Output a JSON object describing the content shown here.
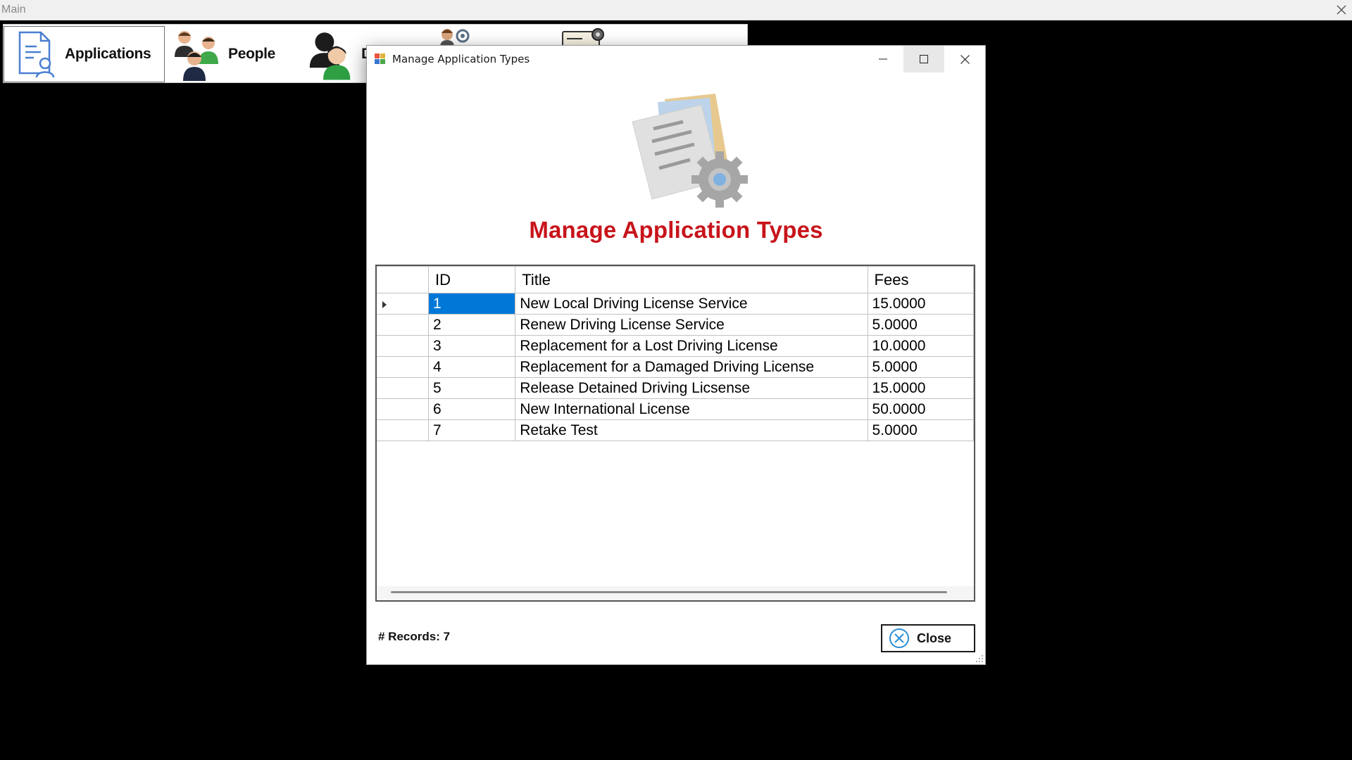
{
  "main_window": {
    "title": "Main"
  },
  "menu": {
    "items": [
      {
        "label": "Applications",
        "icon": "document-user-icon"
      },
      {
        "label": "People",
        "icon": "people-icon"
      },
      {
        "label": "D",
        "icon": "drivers-icon"
      },
      {
        "label": "",
        "icon": "user-settings-icon"
      },
      {
        "label": "",
        "icon": "account-card-icon"
      }
    ]
  },
  "dialog": {
    "title": "Manage Application Types",
    "heading": "Manage Application Types",
    "records_text": "# Records: 7",
    "close_label": "Close",
    "heading_color": "#c8141b",
    "selection_color": "#0078d7"
  },
  "grid": {
    "columns": [
      "ID",
      "Title",
      "Fees"
    ],
    "rows": [
      {
        "id": "1",
        "title": "New Local Driving License Service",
        "fees": "15.0000"
      },
      {
        "id": "2",
        "title": "Renew Driving License Service",
        "fees": "5.0000"
      },
      {
        "id": "3",
        "title": "Replacement for a Lost Driving License",
        "fees": "10.0000"
      },
      {
        "id": "4",
        "title": "Replacement for a Damaged Driving License",
        "fees": "5.0000"
      },
      {
        "id": "5",
        "title": "Release Detained Driving Licsense",
        "fees": "15.0000"
      },
      {
        "id": "6",
        "title": "New International License",
        "fees": "50.0000"
      },
      {
        "id": "7",
        "title": "Retake Test",
        "fees": "5.0000"
      }
    ]
  }
}
